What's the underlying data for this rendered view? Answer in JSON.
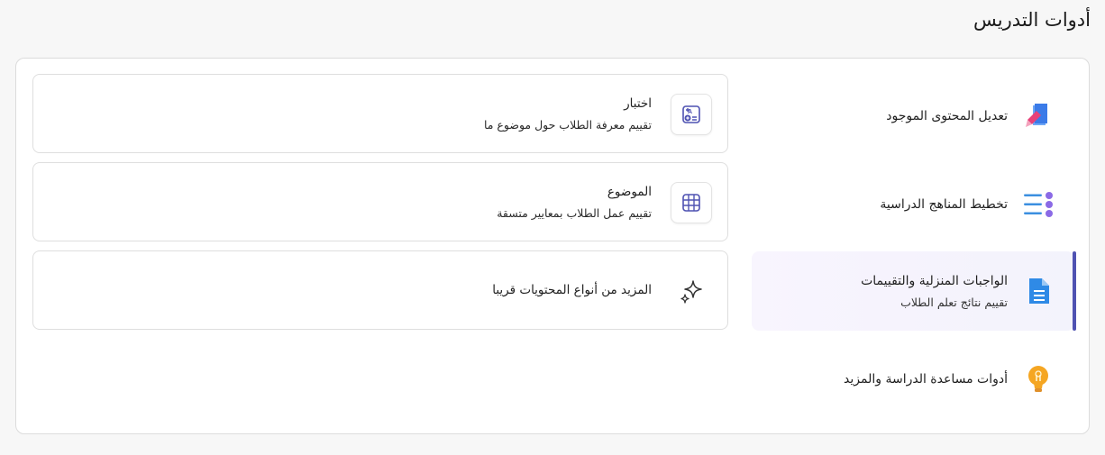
{
  "page": {
    "title": "أدوات التدريس"
  },
  "nav": {
    "items": [
      {
        "label": "تعديل المحتوى الموجود",
        "description": "",
        "icon": "pencil-icon",
        "active": false
      },
      {
        "label": "تخطيط المناهج الدراسية",
        "description": "",
        "icon": "checklist-icon",
        "active": false
      },
      {
        "label": "الواجبات المنزلية والتقييمات",
        "description": "تقييم نتائج تعلم الطلاب",
        "icon": "document-icon",
        "active": true
      },
      {
        "label": "أدوات مساعدة الدراسة والمزيد",
        "description": "",
        "icon": "lightbulb-icon",
        "active": false
      }
    ]
  },
  "cards": [
    {
      "title": "اختبار",
      "description": "تقييم معرفة الطلاب حول موضوع ما",
      "icon": "quiz-icon"
    },
    {
      "title": "الموضوع",
      "description": "تقييم عمل الطلاب بمعايير متسقة",
      "icon": "grid-icon"
    },
    {
      "title": "المزيد من أنواع المحتويات قريبا",
      "description": "",
      "icon": "sparkle-icon"
    }
  ],
  "colors": {
    "accent": "#4f52b2",
    "pencil_blue": "#3b7be8",
    "pencil_pink": "#e8417a",
    "document_blue": "#2f8ae6",
    "bulb_orange": "#f5a623",
    "list_purple": "#8b6ae6"
  }
}
